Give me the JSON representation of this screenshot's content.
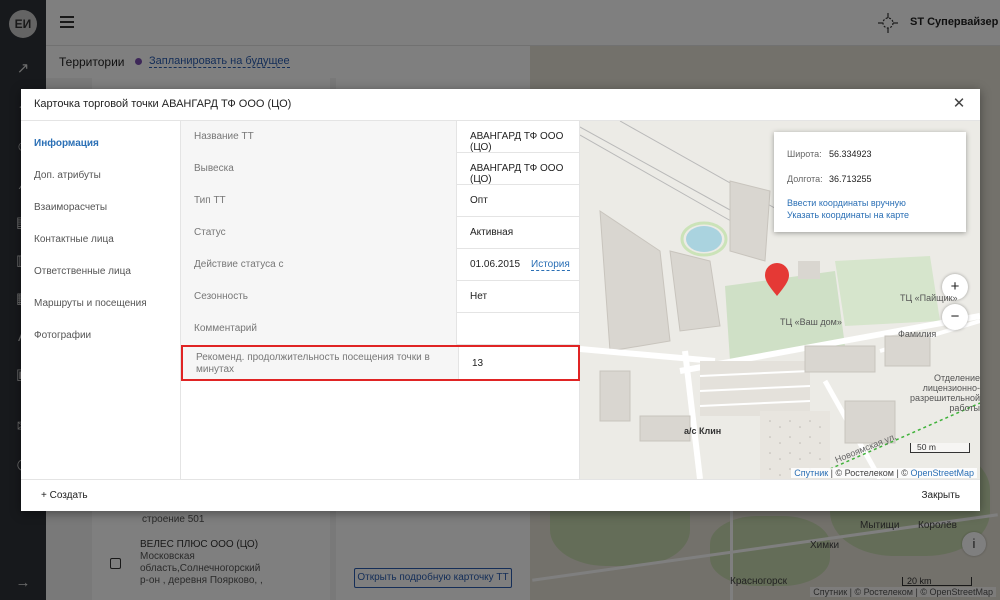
{
  "app": {
    "avatar_initials": "ЕИ",
    "user_name": "ST Супервайзер",
    "subbar_title": "Территории",
    "plan_link": "Запланировать на будущее",
    "bg_list": {
      "item1_address": "строение 501",
      "item2_name": "ВЕЛЕС ПЛЮС ООО (ЦО)",
      "item2_address": "Московская область,Солнечногорский р-он , деревня Поярково, ,"
    },
    "bg_button": "Открыть подробную карточку ТТ",
    "bg_map": {
      "labels": [
        "Мытищи",
        "Королёв",
        "Химки",
        "Красногорск"
      ],
      "scale": "20 km",
      "attribution": "Спутник | © Ростелеком | © OpenStreetMap"
    }
  },
  "modal": {
    "title": "Карточка торговой точки АВАНГАРД ТФ ООО (ЦО)",
    "close_icon": "close-icon",
    "nav": [
      {
        "label": "Информация",
        "active": true
      },
      {
        "label": "Доп. атрибуты",
        "active": false
      },
      {
        "label": "Взаиморасчеты",
        "active": false
      },
      {
        "label": "Контактные лица",
        "active": false
      },
      {
        "label": "Ответственные лица",
        "active": false
      },
      {
        "label": "Маршруты и посещения",
        "active": false
      },
      {
        "label": "Фотографии",
        "active": false
      }
    ],
    "fields": [
      {
        "label": "Название ТТ",
        "value": "АВАНГАРД ТФ ООО (ЦО)"
      },
      {
        "label": "Вывеска",
        "value": "АВАНГАРД ТФ ООО (ЦО)"
      },
      {
        "label": "Тип ТТ",
        "value": "Опт"
      },
      {
        "label": "Статус",
        "value": "Активная"
      },
      {
        "label": "Действие статуса с",
        "value": "01.06.2015",
        "link": "История"
      },
      {
        "label": "Сезонность",
        "value": "Нет"
      },
      {
        "label": "Комментарий",
        "value": ""
      },
      {
        "label": "Рекоменд. продолжительность посещения точки в минутах",
        "value": "13",
        "highlighted": true
      }
    ],
    "map": {
      "latitude_label": "Широта:",
      "latitude": "56.334923",
      "longitude_label": "Долгота:",
      "longitude": "36.713255",
      "enter_manual_link": "Ввести координаты вручную",
      "pick_on_map_link": "Указать координаты на карте",
      "zoom_in": "+",
      "zoom_out": "−",
      "labels": {
        "tc_vash_dom": "ТЦ «Ваш дом»",
        "tc_payshik": "ТЦ «Пайщик»",
        "familia": "Фамилия",
        "otdelenie": "Отделение лицензионно-разрешительной работы",
        "as_klin": "а/с Клин",
        "street": "Новоямская ул."
      },
      "scale": "50 m",
      "attribution_sputnik": "Спутник",
      "attribution_mid": " | © Ростелеком | © ",
      "attribution_osm": "OpenStreetMap",
      "marker_color": "#e53935"
    },
    "footer": {
      "create": "+ Создать",
      "close": "Закрыть"
    }
  },
  "colors": {
    "accent": "#2a6fb5",
    "highlight_border": "#e02424",
    "rail": "#2f3338"
  }
}
